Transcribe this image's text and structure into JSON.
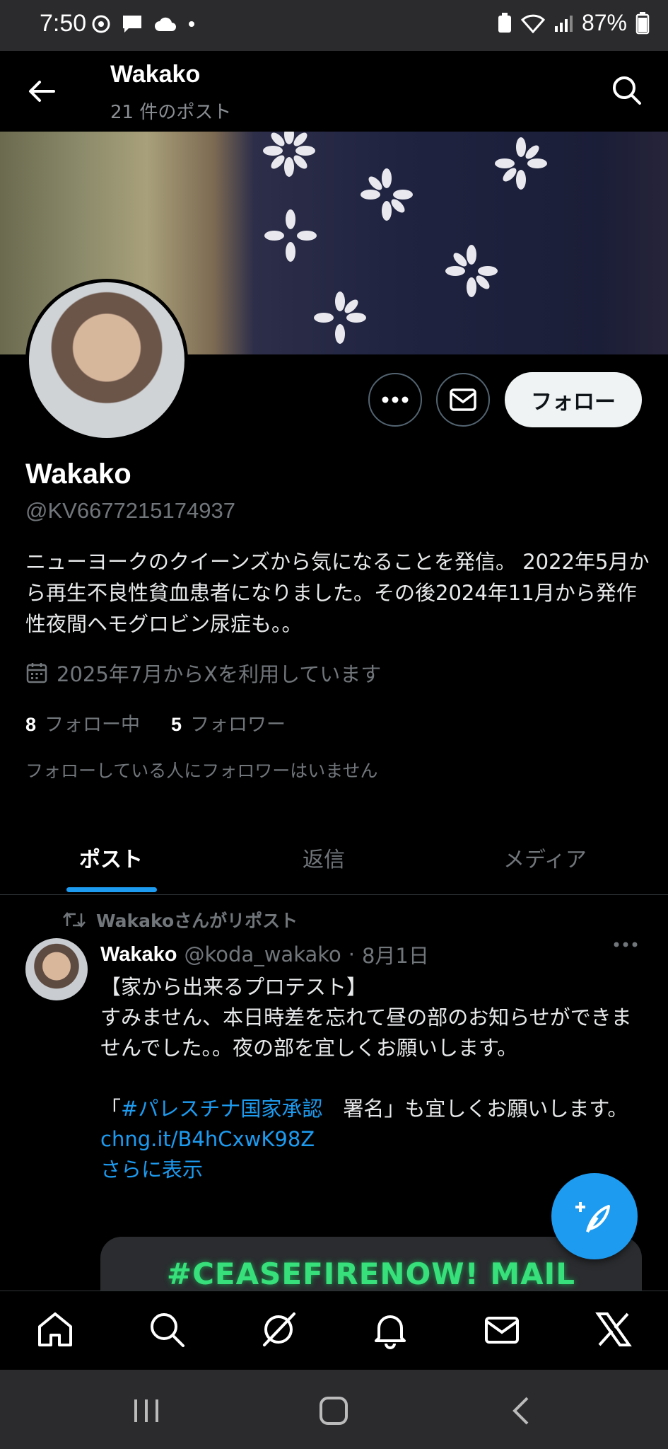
{
  "status_bar": {
    "time": "7:50",
    "battery": "87%"
  },
  "header": {
    "title": "Wakako",
    "subtitle": "21 件のポスト"
  },
  "profile": {
    "follow_label": "フォロー",
    "name": "Wakako",
    "handle": "@KV6677215174937",
    "bio": "ニューヨークのクイーンズから気になることを発信。 2022年5月から再生不良性貧血患者になりました。その後2024年11月から発作性夜間ヘモグロビン尿症も。。",
    "joined": "2025年7月からXを利用しています",
    "following_count": "8",
    "following_label": "フォロー中",
    "followers_count": "5",
    "followers_label": "フォロワー",
    "no_mutual": "フォローしている人にフォロワーはいません"
  },
  "tabs": [
    {
      "label": "ポスト",
      "active": true
    },
    {
      "label": "返信",
      "active": false
    },
    {
      "label": "メディア",
      "active": false
    }
  ],
  "post": {
    "repost_label": "Wakakoさんがリポスト",
    "author_name": "Wakako",
    "author_handle": "@koda_wakako",
    "separator": "·",
    "date": "8月1日",
    "line1": "【家から出来るプロテスト】",
    "line2": "すみません、本日時差を忘れて昼の部のお知らせができませんでした。。夜の部を宜しくお願いします。",
    "line3_prefix": "「",
    "hashtag": "#パレスチナ国家承認",
    "line3_suffix": "　署名」も宜しくお願いします。",
    "link": "chng.it/B4hCxwK98Z",
    "show_more": "さらに表示",
    "card_text": "#CEASEFIRENOW! MAIL STORM ACTION"
  },
  "colors": {
    "accent": "#1d9bf0",
    "background": "#000000",
    "muted": "#71767b"
  }
}
